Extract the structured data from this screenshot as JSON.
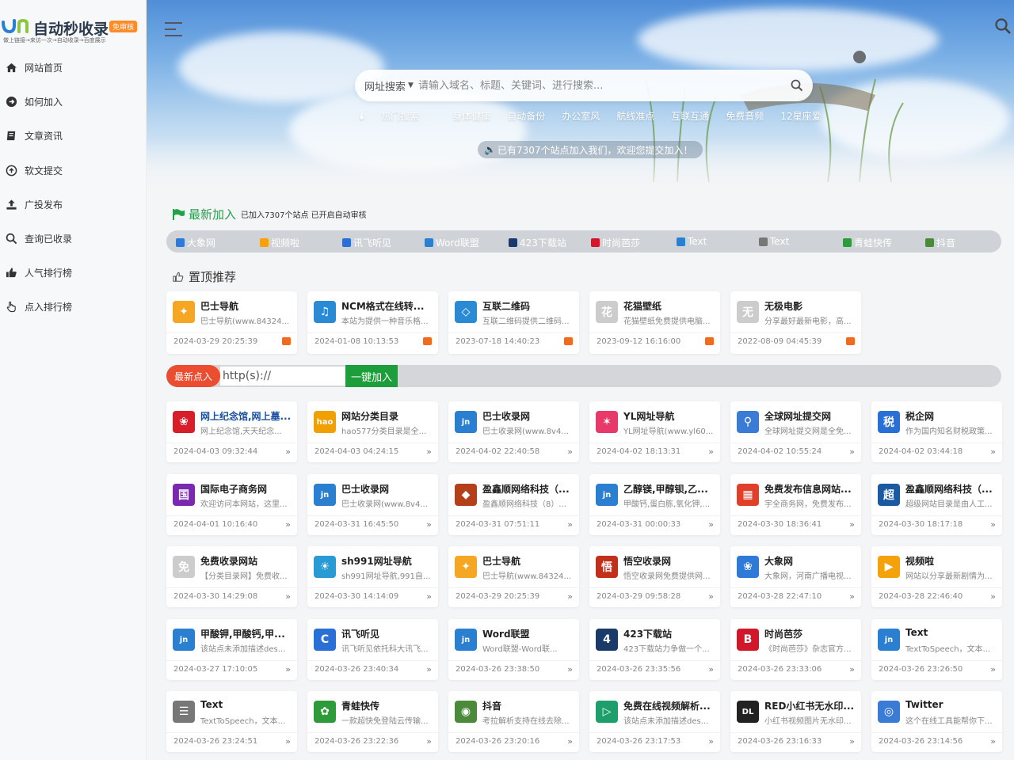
{
  "logo": {
    "text": "自动秒收录",
    "badge": "免审核",
    "slogan": "做上链接→来访一次→自动收录→百度展示"
  },
  "nav": [
    {
      "label": "网站首页",
      "icon": "home-icon"
    },
    {
      "label": "如何加入",
      "icon": "arrow-circle-icon"
    },
    {
      "label": "文章资讯",
      "icon": "book-icon"
    },
    {
      "label": "软文提交",
      "icon": "upload-circle-icon"
    },
    {
      "label": "广投发布",
      "icon": "upload-icon"
    },
    {
      "label": "查询已收录",
      "icon": "search-icon"
    },
    {
      "label": "人气排行榜",
      "icon": "thumbs-up-icon"
    },
    {
      "label": "点入排行榜",
      "icon": "hand-pointer-icon"
    }
  ],
  "search": {
    "type": "网址搜索",
    "placeholder": "请输入域名、标题、关键词、进行搜索..."
  },
  "hot_tags": [
    "热门搜索",
    "身体健康",
    "自动备份",
    "办公室风",
    "航线准点",
    "互联互通",
    "免费音频",
    "12星座爱"
  ],
  "notice": "已有7307个站点加入我们，欢迎您提交加入！",
  "latest": {
    "title": "最新加入",
    "subtitle": "已加入7307个站点 已开启自动审核",
    "strip": [
      {
        "label": "大象网",
        "color": "#2f79d8"
      },
      {
        "label": "视频啦",
        "color": "#f5a20a"
      },
      {
        "label": "讯飞听见",
        "color": "#2a6fd6"
      },
      {
        "label": "Word联盟",
        "color": "#2a7fd0"
      },
      {
        "label": "423下载站",
        "color": "#1a3a6a"
      },
      {
        "label": "时尚芭莎",
        "color": "#d0182a"
      },
      {
        "label": "Text",
        "color": "#2a7fd0"
      },
      {
        "label": "Text",
        "color": "#777777"
      },
      {
        "label": "青蛙快传",
        "color": "#2e9b3b"
      },
      {
        "label": "抖音",
        "color": "#4a8a3a"
      }
    ]
  },
  "top_title": "置顶推荐",
  "top_cards": [
    {
      "title": "巴士导航",
      "desc": "巴士导航(www.84324...",
      "time": "2024-03-29 20:25:39",
      "color": "#f5a623",
      "glyph": "✦"
    },
    {
      "title": "NCM格式在线转...",
      "desc": "本站为提供一种音乐格...",
      "time": "2024-01-08 10:13:53",
      "color": "#2a8ad4",
      "glyph": "♫"
    },
    {
      "title": "互联二维码",
      "desc": "互联二维码提供二维码...",
      "time": "2023-07-18 14:40:23",
      "color": "#2a8ad4",
      "glyph": "◇"
    },
    {
      "title": "花猫壁纸",
      "desc": "花猫壁纸免费提供电脑...",
      "time": "2023-09-12 16:16:00",
      "color": "#cccccc",
      "glyph": "花"
    },
    {
      "title": "无极电影",
      "desc": "分享最好最新电影，高...",
      "time": "2022-08-09 04:45:39",
      "color": "#cccccc",
      "glyph": "无"
    }
  ],
  "submit": {
    "label": "最新点入",
    "placeholder": "http(s)://",
    "button": "一键加入"
  },
  "grid_cards": [
    {
      "title": "网上纪念馆,网上墓...",
      "desc": "网上纪念馆,天天纪念...",
      "time": "2024-04-03 09:32:44",
      "color": "#d81e2a",
      "glyph": "❀",
      "blue": true
    },
    {
      "title": "网站分类目录",
      "desc": "hao577分类目录是全...",
      "time": "2024-04-03 04:24:15",
      "color": "#f0a000",
      "glyph": "hao"
    },
    {
      "title": "巴士收录网",
      "desc": "巴士收录网(www.8v4...",
      "time": "2024-04-02 22:40:58",
      "color": "#2a7fd0",
      "glyph": "jn"
    },
    {
      "title": "YL网址导航",
      "desc": "YL网址导航(www.yl60...",
      "time": "2024-04-02 18:13:31",
      "color": "#e83a6a",
      "glyph": "✶"
    },
    {
      "title": "全球网址提交网",
      "desc": "全球网址提交网是全免...",
      "time": "2024-04-02 10:55:24",
      "color": "#3a7bd5",
      "glyph": "⚲"
    },
    {
      "title": "税企网",
      "desc": "作为国内知名财税政策...",
      "time": "2024-04-02 03:44:18",
      "color": "#2a6fd6",
      "glyph": "税"
    },
    {
      "title": "国际电子商务网",
      "desc": "欢迎访问本网站，这里...",
      "time": "2024-04-01 10:16:40",
      "color": "#7a2ab0",
      "glyph": "国"
    },
    {
      "title": "巴士收录网",
      "desc": "巴士收录网(www.8v4...",
      "time": "2024-03-31 16:45:50",
      "color": "#2a7fd0",
      "glyph": "jn"
    },
    {
      "title": "盈鑫顺网络科技（...",
      "desc": "盈鑫顺网络科技（8）...",
      "time": "2024-03-31 07:51:11",
      "color": "#b3401a",
      "glyph": "◆"
    },
    {
      "title": "乙醇镁,甲醇钡,乙...",
      "desc": "甲酸钙,蛋白胨,氧化钾,...",
      "time": "2024-03-31 00:00:33",
      "color": "#2a7fd0",
      "glyph": "jn"
    },
    {
      "title": "免费发布信息网站...",
      "desc": "宇全商务网，免费发布...",
      "time": "2024-03-30 18:36:41",
      "color": "#e0402a",
      "glyph": "▦"
    },
    {
      "title": "盈鑫顺网络科技（...",
      "desc": "超级网站目录是由人工...",
      "time": "2024-03-30 18:17:18",
      "color": "#1a5aa0",
      "glyph": "超"
    },
    {
      "title": "免费收录网站",
      "desc": "【分类目录网】免费收...",
      "time": "2024-03-30 14:29:08",
      "color": "#cccccc",
      "glyph": "免"
    },
    {
      "title": "sh991网址导航",
      "desc": "sh991网址导航,991自...",
      "time": "2024-03-30 14:14:09",
      "color": "#2a9ad4",
      "glyph": "☀"
    },
    {
      "title": "巴士导航",
      "desc": "巴士导航(www.84324...",
      "time": "2024-03-29 20:25:39",
      "color": "#f5a623",
      "glyph": "✦"
    },
    {
      "title": "悟空收录网",
      "desc": "悟空收录网免费提供网...",
      "time": "2024-03-29 09:58:28",
      "color": "#c0301a",
      "glyph": "悟"
    },
    {
      "title": "大象网",
      "desc": "大象网，河南广播电视...",
      "time": "2024-03-28 22:47:10",
      "color": "#2f79d8",
      "glyph": "❀"
    },
    {
      "title": "视频啦",
      "desc": "网站以分享最新剧情为...",
      "time": "2024-03-28 22:46:40",
      "color": "#f5a20a",
      "glyph": "▶"
    },
    {
      "title": "甲酸钾,甲酸钙,甲...",
      "desc": "该站点未添加描述des...",
      "time": "2024-03-27 17:10:05",
      "color": "#2a7fd0",
      "glyph": "jn"
    },
    {
      "title": "讯飞听见",
      "desc": "讯飞听见依托科大讯飞...",
      "time": "2024-03-26 23:40:34",
      "color": "#2a6fd6",
      "glyph": "C"
    },
    {
      "title": "Word联盟",
      "desc": "Word联盟-Word联...",
      "time": "2024-03-26 23:38:50",
      "color": "#2a7fd0",
      "glyph": "jn"
    },
    {
      "title": "423下载站",
      "desc": "423下载站力争做一个...",
      "time": "2024-03-26 23:35:56",
      "color": "#1a3a6a",
      "glyph": "4"
    },
    {
      "title": "时尚芭莎",
      "desc": "《时尚芭莎》杂志官方...",
      "time": "2024-03-26 23:33:06",
      "color": "#d0182a",
      "glyph": "B"
    },
    {
      "title": "Text",
      "desc": "TextToSpeech，文本...",
      "time": "2024-03-26 23:26:50",
      "color": "#2a7fd0",
      "glyph": "jn"
    },
    {
      "title": "Text",
      "desc": "TextToSpeech，文本...",
      "time": "2024-03-26 23:24:51",
      "color": "#777777",
      "glyph": "☰"
    },
    {
      "title": "青蛙快传",
      "desc": "一款超快免登陆云传输...",
      "time": "2024-03-26 23:22:36",
      "color": "#2e9b3b",
      "glyph": "✿"
    },
    {
      "title": "抖音",
      "desc": "考拉解析支持在线去除...",
      "time": "2024-03-26 23:20:16",
      "color": "#4a8a3a",
      "glyph": "◉"
    },
    {
      "title": "免费在线视频解析...",
      "desc": "该站点未添加描述des...",
      "time": "2024-03-26 23:17:53",
      "color": "#1e9e6a",
      "glyph": "▷"
    },
    {
      "title": "RED小红书无水印...",
      "desc": "小红书视频图片无水印...",
      "time": "2024-03-26 23:16:33",
      "color": "#222222",
      "glyph": "DL"
    },
    {
      "title": "Twitter",
      "desc": "这个在线工具能帮你下...",
      "time": "2024-03-26 23:14:56",
      "color": "#3a7bd5",
      "glyph": "◎"
    }
  ]
}
